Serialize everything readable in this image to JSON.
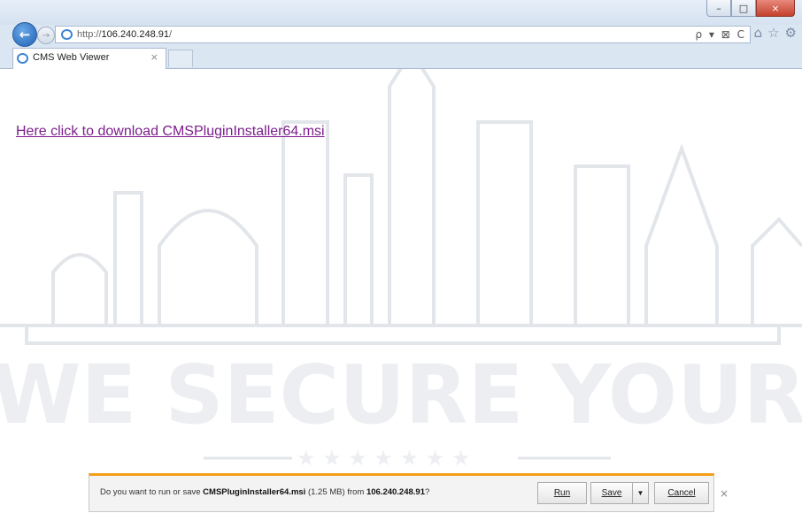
{
  "browser": {
    "url_scheme": "http://",
    "url_host": "106.240.248.91",
    "url_path": "/",
    "tab_title": "CMS Web Viewer",
    "tab_close": "×",
    "window_min": "–",
    "window_max": "□",
    "window_close": "×",
    "back_glyph": "←",
    "forward_glyph": "→",
    "addr_tools": "ρ ▾ ⊠ C",
    "icons": [
      "back-arrow-icon",
      "forward-arrow-icon",
      "ie-logo-icon",
      "search-icon",
      "compatibility-icon",
      "refresh-icon",
      "home-icon",
      "favorites-star-icon",
      "gear-icon"
    ]
  },
  "page": {
    "download_link": "Here click to download CMSPluginInstaller64.msi",
    "watermark_text": "WE SECURE YOUR LIFE",
    "link_color": "#7c1e8c"
  },
  "notification": {
    "prefix": "Do you want to run or save ",
    "filename": "CMSPluginInstaller64.msi",
    "size": " (1.25 MB) from ",
    "host": "106.240.248.91",
    "suffix": "?",
    "run_label": "Run",
    "save_label": "Save",
    "save_arrow": "▼",
    "cancel_label": "Cancel",
    "close": "×",
    "accent": "#f2a01a"
  }
}
